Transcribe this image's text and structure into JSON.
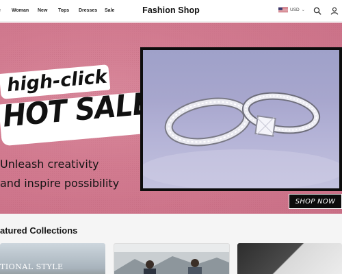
{
  "header": {
    "nav": [
      {
        "label": "e",
        "name": "nav-item-home"
      },
      {
        "label": "Woman",
        "name": "nav-item-woman"
      },
      {
        "label": "New",
        "name": "nav-item-new"
      },
      {
        "label": "Tops",
        "name": "nav-item-tops"
      },
      {
        "label": "Dresses",
        "name": "nav-item-dresses"
      },
      {
        "label": "Sale",
        "name": "nav-item-sale"
      }
    ],
    "brand": "Fashion Shop",
    "currency": {
      "label": "USD",
      "flag_icon": "us-flag-icon",
      "chevron_icon": "chevron-down-icon"
    },
    "icons": [
      "search-icon",
      "user-icon"
    ]
  },
  "hero": {
    "headline_small": "high-click",
    "headline_large": "HOT SALE",
    "tagline_line1": "Unleash creativity",
    "tagline_line2": "and inspire possibility",
    "cta_label": "SHOP NOW",
    "image_icon": "wedding-rings-photo",
    "background_color": "#d17a8f"
  },
  "collections": {
    "title": "atured Collections",
    "cards": [
      {
        "caption": "TIONAL STYLE",
        "name": "collection-card-national-style"
      },
      {
        "caption": "",
        "name": "collection-card-men"
      },
      {
        "caption": "",
        "name": "collection-card-accessories"
      }
    ]
  }
}
